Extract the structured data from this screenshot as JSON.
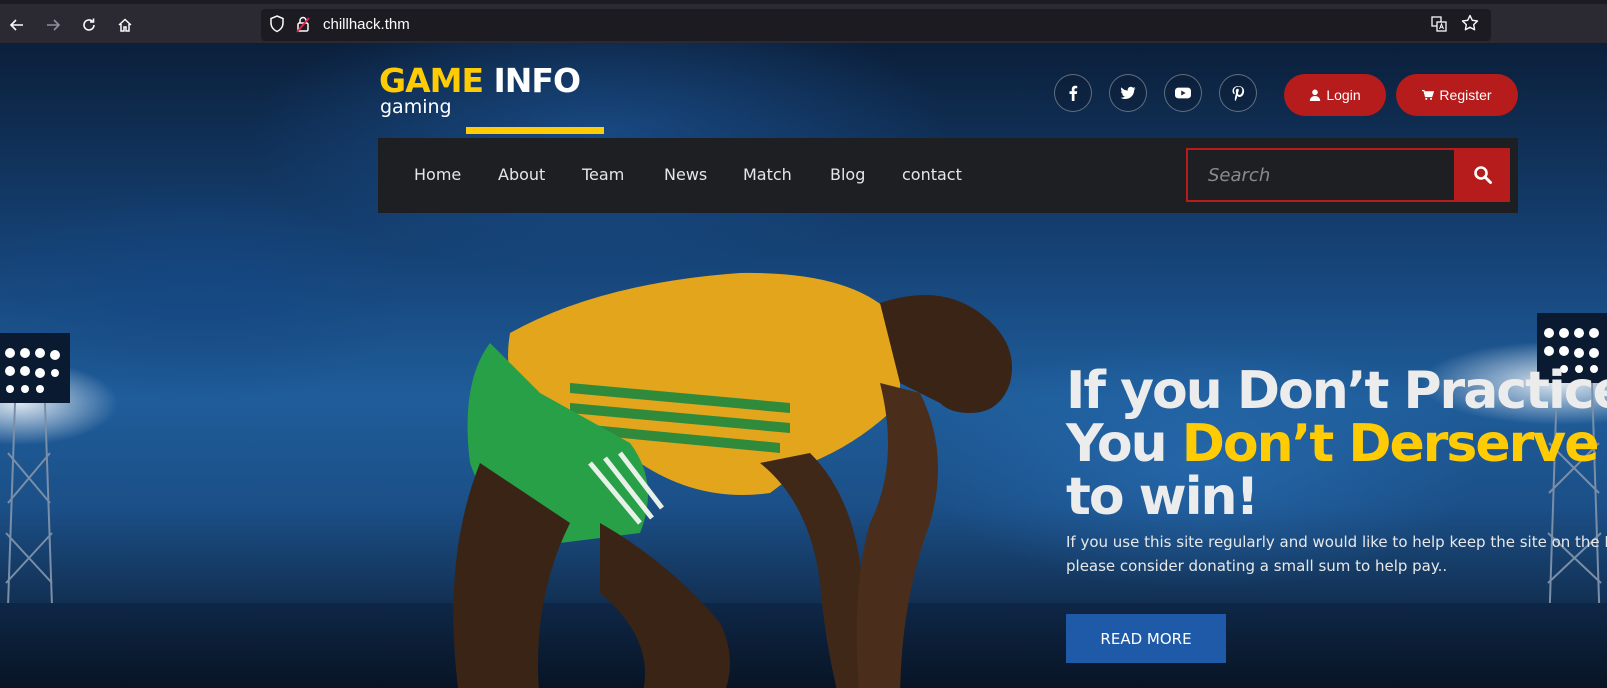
{
  "browser": {
    "url": "chillhack.thm",
    "back_icon": "arrow-left-icon",
    "forward_icon": "arrow-right-icon",
    "reload_icon": "reload-icon",
    "home_icon": "home-icon"
  },
  "header": {
    "logo": {
      "word1": "GAME",
      "word2": "INFO",
      "subtitle": "gaming"
    },
    "social": [
      "facebook-icon",
      "twitter-icon",
      "youtube-icon",
      "pinterest-icon"
    ],
    "login_label": "Login",
    "register_label": "Register"
  },
  "menu": {
    "items": [
      "Home",
      "About",
      "Team",
      "News",
      "Match",
      "Blog",
      "contact"
    ]
  },
  "search": {
    "placeholder": "Search"
  },
  "hero": {
    "line1": "If you Don’t Practice",
    "line2_prefix": "You ",
    "line2_highlight": "Don’t Derserve",
    "line3": "to win!",
    "sub_line1": "If you use this site regularly and would like to help keep the site on the Int",
    "sub_line2": "please consider donating a small sum to help pay..",
    "button_label": "READ MORE"
  },
  "colors": {
    "accent_yellow": "#ffcb05",
    "accent_red": "#b71c1c",
    "button_blue": "#1e5aa8",
    "menu_bg": "#1d1f22"
  }
}
